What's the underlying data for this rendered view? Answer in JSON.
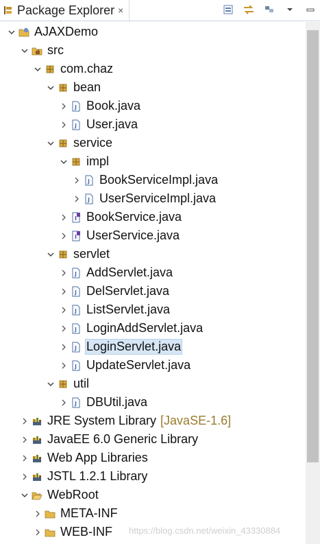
{
  "header": {
    "tab_title": "Package Explorer",
    "close_glyph": "×"
  },
  "tree": [
    {
      "label": "AJAXDemo",
      "depth": 0,
      "twisty": "open",
      "icon": "project-icon"
    },
    {
      "label": "src",
      "depth": 1,
      "twisty": "open",
      "icon": "source-folder-icon"
    },
    {
      "label": "com.chaz",
      "depth": 2,
      "twisty": "open",
      "icon": "package-icon"
    },
    {
      "label": "bean",
      "depth": 3,
      "twisty": "open",
      "icon": "package-icon"
    },
    {
      "label": "Book.java",
      "depth": 4,
      "twisty": "closed",
      "icon": "java-file-icon"
    },
    {
      "label": "User.java",
      "depth": 4,
      "twisty": "closed",
      "icon": "java-file-icon"
    },
    {
      "label": "service",
      "depth": 3,
      "twisty": "open",
      "icon": "package-icon"
    },
    {
      "label": "impl",
      "depth": 4,
      "twisty": "open",
      "icon": "package-icon"
    },
    {
      "label": "BookServiceImpl.java",
      "depth": 5,
      "twisty": "closed",
      "icon": "java-file-icon"
    },
    {
      "label": "UserServiceImpl.java",
      "depth": 5,
      "twisty": "closed",
      "icon": "java-file-icon"
    },
    {
      "label": "BookService.java",
      "depth": 4,
      "twisty": "closed",
      "icon": "java-interface-icon"
    },
    {
      "label": "UserService.java",
      "depth": 4,
      "twisty": "closed",
      "icon": "java-interface-icon"
    },
    {
      "label": "servlet",
      "depth": 3,
      "twisty": "open",
      "icon": "package-icon"
    },
    {
      "label": "AddServlet.java",
      "depth": 4,
      "twisty": "closed",
      "icon": "java-file-icon"
    },
    {
      "label": "DelServlet.java",
      "depth": 4,
      "twisty": "closed",
      "icon": "java-file-icon"
    },
    {
      "label": "ListServlet.java",
      "depth": 4,
      "twisty": "closed",
      "icon": "java-file-icon"
    },
    {
      "label": "LoginAddServlet.java",
      "depth": 4,
      "twisty": "closed",
      "icon": "java-file-icon"
    },
    {
      "label": "LoginServlet.java",
      "depth": 4,
      "twisty": "closed",
      "icon": "java-file-icon",
      "selected": true
    },
    {
      "label": "UpdateServlet.java",
      "depth": 4,
      "twisty": "closed",
      "icon": "java-file-icon"
    },
    {
      "label": "util",
      "depth": 3,
      "twisty": "open",
      "icon": "package-icon"
    },
    {
      "label": "DBUtil.java",
      "depth": 4,
      "twisty": "closed",
      "icon": "java-file-icon"
    },
    {
      "label": "JRE System Library",
      "depth": 1,
      "twisty": "closed",
      "icon": "library-icon",
      "decoration": "[JavaSE-1.6]"
    },
    {
      "label": "JavaEE 6.0 Generic Library",
      "depth": 1,
      "twisty": "closed",
      "icon": "library-icon"
    },
    {
      "label": "Web App Libraries",
      "depth": 1,
      "twisty": "closed",
      "icon": "library-icon"
    },
    {
      "label": "JSTL 1.2.1 Library",
      "depth": 1,
      "twisty": "closed",
      "icon": "library-icon"
    },
    {
      "label": "WebRoot",
      "depth": 1,
      "twisty": "open",
      "icon": "folder-open-icon"
    },
    {
      "label": "META-INF",
      "depth": 2,
      "twisty": "closed",
      "icon": "folder-icon"
    },
    {
      "label": "WEB-INF",
      "depth": 2,
      "twisty": "closed",
      "icon": "folder-icon"
    }
  ],
  "watermark": "https://blog.csdn.net/weixin_43330884",
  "colors": {
    "selection": "#d6e6f5",
    "package": "#b8860b",
    "java": "#4a6fa5",
    "folder": "#e6b84a",
    "decoration": "#9b7b2f"
  }
}
